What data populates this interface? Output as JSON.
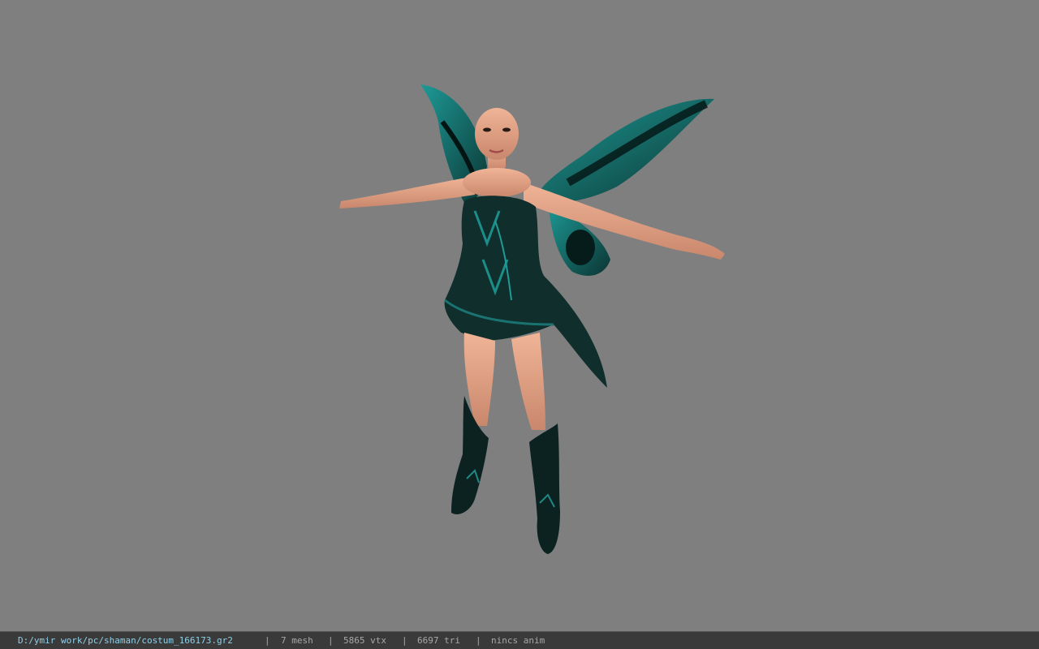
{
  "status_bar": {
    "file_path": "D:/ymir work/pc/shaman/costum_166173.gr2",
    "separator": "|",
    "mesh_count": "7 mesh",
    "vertex_count": "5865 vtx",
    "triangle_count": "6697 tri",
    "animation": "nincs anim"
  },
  "colors": {
    "viewport_bg": "#7f7f7f",
    "statusbar_bg": "#3a3a3a",
    "path_text": "#8fd0e8",
    "info_text": "#a8a8a8",
    "costume_teal": "#1f8f8c",
    "costume_dark": "#0d2423",
    "skin": "#e8a98c"
  }
}
